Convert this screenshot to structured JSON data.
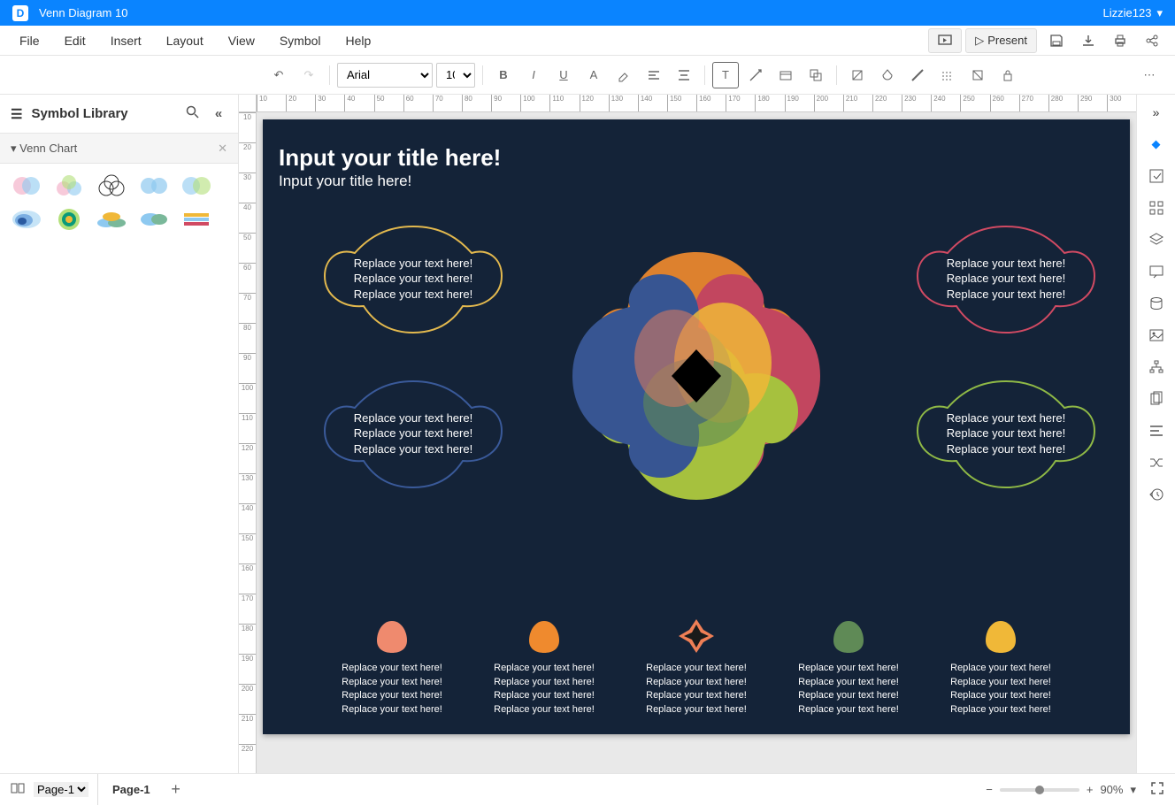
{
  "app": {
    "title": "Venn Diagram 10",
    "user": "Lizzie123"
  },
  "menu": [
    "File",
    "Edit",
    "Insert",
    "Layout",
    "View",
    "Symbol",
    "Help"
  ],
  "present": "Present",
  "toolbar": {
    "font": "Arial",
    "size": "10"
  },
  "sidebar": {
    "title": "Symbol Library",
    "category": "Venn Chart"
  },
  "canvas": {
    "title": "Input your title here!",
    "subtitle": "Input your title here!",
    "callout_text": "Replace your text here!   Replace your text here!   Replace your text here!",
    "legend_text": "Replace your text here!   Replace your text here!   Replace your text here!   Replace your text here!",
    "callouts": [
      {
        "color": "#e3b94e"
      },
      {
        "color": "#d14a63"
      },
      {
        "color": "#3a5a9a"
      },
      {
        "color": "#8fb946"
      }
    ],
    "venn_colors": {
      "top": "#ef8a2e",
      "right": "#d14a63",
      "bottom": "#b3cf3f",
      "left": "#3a5a9a",
      "midA": "#f0b838",
      "midB": "#5f8a56",
      "midC": "#ef7f56"
    },
    "legend": [
      {
        "color": "#ef8a6e"
      },
      {
        "color": "#ef8a2e"
      },
      {
        "color": "#3a2a2a"
      },
      {
        "color": "#5f8a56"
      },
      {
        "color": "#f0b838"
      }
    ]
  },
  "status": {
    "pages": "Page-1",
    "currentTab": "Page-1",
    "zoom": "90%"
  }
}
